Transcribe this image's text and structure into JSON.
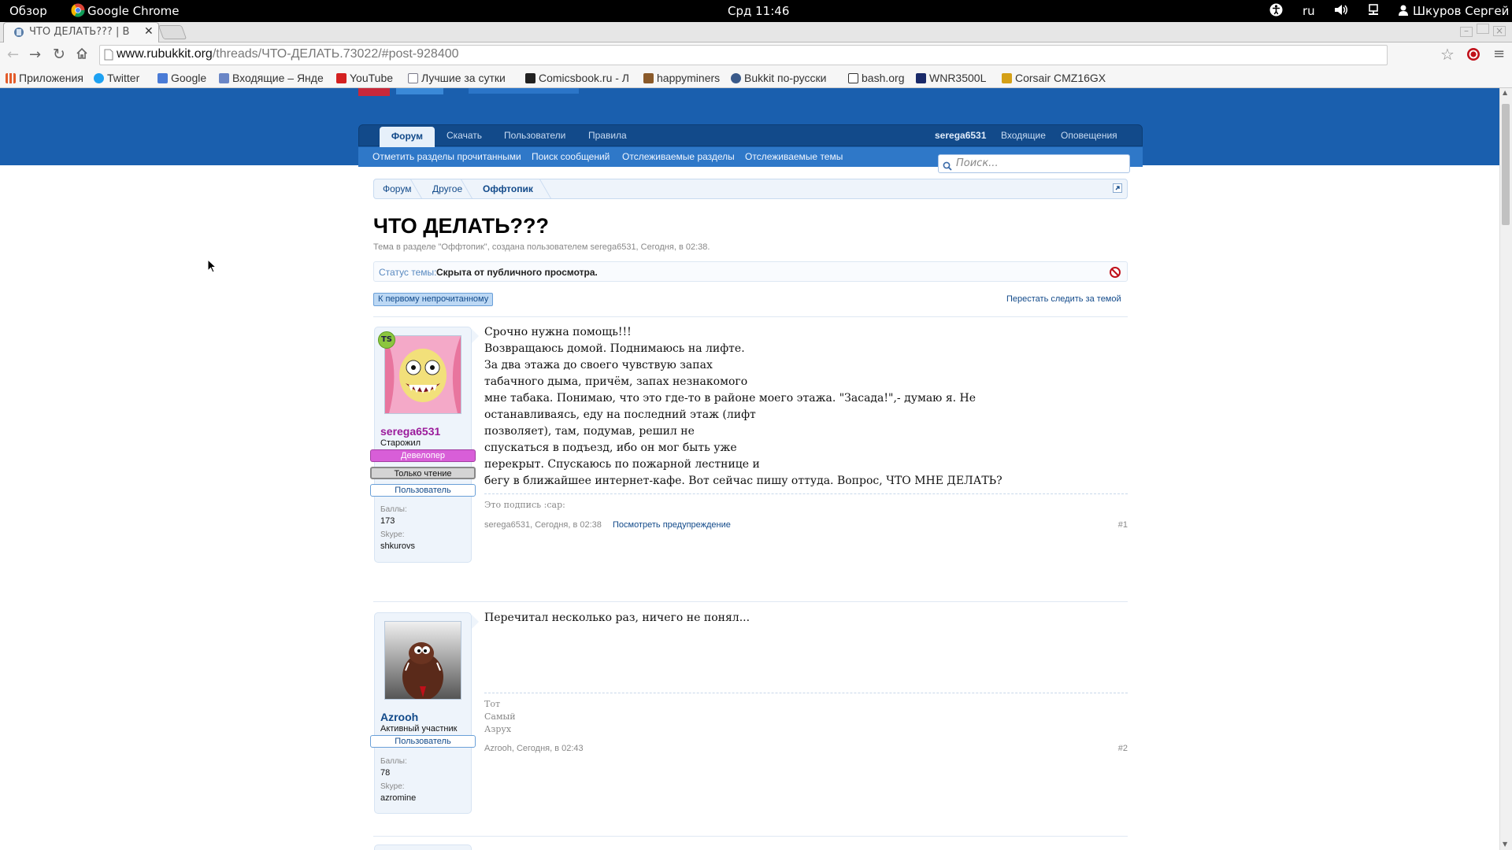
{
  "system_bar": {
    "activities": "Обзор",
    "app_name": "Google Chrome",
    "clock": "Срд 11:46",
    "keyboard_layout": "ru",
    "user_name": "Шкуров Сергей"
  },
  "browser": {
    "tab_title": "ЧТО ДЕЛАТЬ??? | В",
    "url_host": "www.rubukkit.org",
    "url_path": "/threads/ЧТО-ДЕЛАТЬ.73022/#post-928400",
    "bookmarks": [
      {
        "label": "Приложения",
        "icon": "apps-grid-icon",
        "color": "#e35c2b"
      },
      {
        "label": "Twitter",
        "icon": "twitter-icon",
        "color": "#1da1f2"
      },
      {
        "label": "Google",
        "icon": "google-plus-icon",
        "color": "#4a7bd6"
      },
      {
        "label": "Входящие – Янде",
        "icon": "mail-icon",
        "color": "#6a86c6"
      },
      {
        "label": "YouTube",
        "icon": "youtube-icon",
        "color": "#d32020"
      },
      {
        "label": "Лучшие за сутки",
        "icon": "page-icon",
        "color": "#7a7a8a"
      },
      {
        "label": "Comicsbook.ru - Л",
        "icon": "comics-icon",
        "color": "#222222"
      },
      {
        "label": "happyminers",
        "icon": "miner-icon",
        "color": "#8a5a2a"
      },
      {
        "label": "Bukkit по-русски",
        "icon": "bukkit-icon",
        "color": "#3a5a8a"
      },
      {
        "label": "bash.org",
        "icon": "bash-icon",
        "color": "#333333"
      },
      {
        "label": "WNR3500L",
        "icon": "netgear-icon",
        "color": "#1a2a6a"
      },
      {
        "label": "Corsair CMZ16GX",
        "icon": "corsair-icon",
        "color": "#d4a017"
      }
    ]
  },
  "nav": {
    "tabs": [
      "Форум",
      "Скачать",
      "Пользователи",
      "Правила"
    ],
    "user": "serega6531",
    "inbox": "Входящие",
    "alerts": "Оповещения",
    "sublinks": [
      "Отметить разделы прочитанными",
      "Поиск сообщений",
      "Отслеживаемые разделы",
      "Отслеживаемые темы"
    ],
    "search_placeholder": "Поиск..."
  },
  "breadcrumb": [
    "Форум",
    "Другое",
    "Оффтопик"
  ],
  "thread": {
    "title": "ЧТО ДЕЛАТЬ???",
    "meta": "Тема в разделе \"Оффтопик\", создана пользователем serega6531, Сегодня, в 02:38.",
    "status_label": "Статус темы:",
    "status_value": "Скрыта от публичного просмотра.",
    "unread_button": "К первому непрочитанному",
    "unwatch_link": "Перестать следить за темой"
  },
  "posts": [
    {
      "author": "serega6531",
      "author_color": "#9b1b9b",
      "badge": "TS",
      "rank": "Старожил",
      "banners": [
        "Девелопер",
        "Только чтение",
        "Пользователь"
      ],
      "points_label": "Баллы:",
      "points": "173",
      "skype_label": "Skype:",
      "skype": "shkurovs",
      "lines": [
        "Срочно нужна помощь!!!",
        "Возвращаюсь домой. Поднимаюсь на лифте.",
        "За два этажа до своего чувствую запах",
        "табачного дыма, причём, запах незнакомого",
        "мне табака. Понимаю, что это где-то в районе моего этажа. \"Засада!\",- думаю я. Не",
        "останавливаясь, еду на последний этаж (лифт",
        "позволяет), там, подумав, решил не",
        "спускаться в подъезд, ибо он мог быть уже",
        "перекрыт. Спускаюсь по пожарной лестнице и",
        "бегу в ближайшее интернет-кафе. Вот сейчас пишу оттуда. Вопрос, ЧТО МНЕ ДЕЛАТЬ?"
      ],
      "signature": [
        "Это подпись :cap:"
      ],
      "footer": "serega6531, Сегодня, в 02:38",
      "warning_link": "Посмотреть предупреждение",
      "number": "#1"
    },
    {
      "author": "Azrooh",
      "author_color": "#124a8a",
      "rank": "Активный участник",
      "banners": [
        "Пользователь"
      ],
      "points_label": "Баллы:",
      "points": "78",
      "skype_label": "Skype:",
      "skype": "azromine",
      "lines": [
        "Перечитал несколько раз, ничего не понял..."
      ],
      "signature": [
        "Тот",
        "Самый",
        "Азрух"
      ],
      "footer": "Azrooh, Сегодня, в 02:43",
      "number": "#2"
    }
  ]
}
